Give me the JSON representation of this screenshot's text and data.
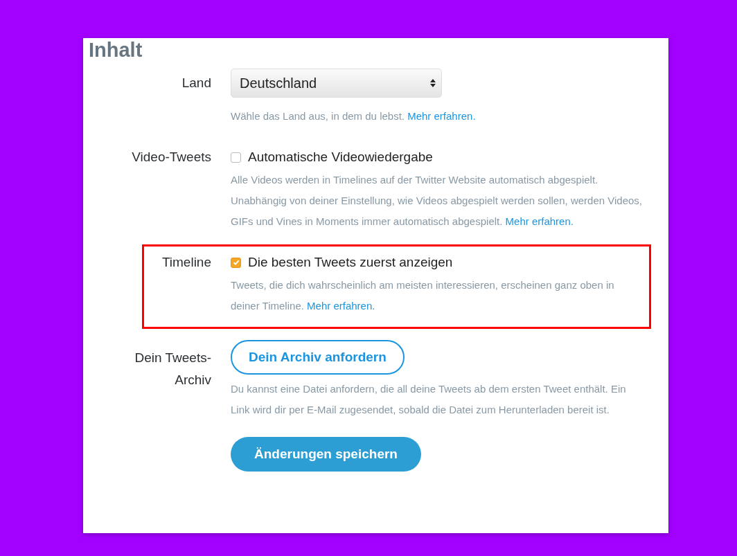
{
  "section": {
    "title": "Inhalt"
  },
  "rows": [
    {
      "kind": "select",
      "label": "Land",
      "value": "Deutschland",
      "help": "Wähle das Land aus, in dem du lebst.",
      "link": "Mehr erfahren.",
      "highlighted": false
    },
    {
      "kind": "checkbox",
      "label": "Video-Tweets",
      "option": "Automatische Videowiedergabe",
      "checked": false,
      "help": "Alle Videos werden in Timelines auf der Twitter Website automatisch abgespielt. Unabhängig von deiner Einstellung, wie Videos abgespielt werden sollen, werden Videos, GIFs und Vines in Moments immer automatisch abgespielt.",
      "link": "Mehr erfahren.",
      "highlighted": false
    },
    {
      "kind": "checkbox",
      "label": "Timeline",
      "option": "Die besten Tweets zuerst anzeigen",
      "checked": true,
      "help": "Tweets, die dich wahrscheinlich am meisten interessieren, erscheinen ganz oben in deiner Timeline.",
      "link": "Mehr erfahren.",
      "highlighted": true
    },
    {
      "kind": "button",
      "label": "Dein Tweets-Archiv",
      "button": "Dein Archiv anfordern",
      "help": "Du kannst eine Datei anfordern, die all deine Tweets ab dem ersten Tweet enthält. Ein Link wird dir per E-Mail zugesendet, sobald die Datei zum Herunterladen bereit ist.",
      "highlighted": false
    }
  ],
  "save_button": "Änderungen speichern"
}
